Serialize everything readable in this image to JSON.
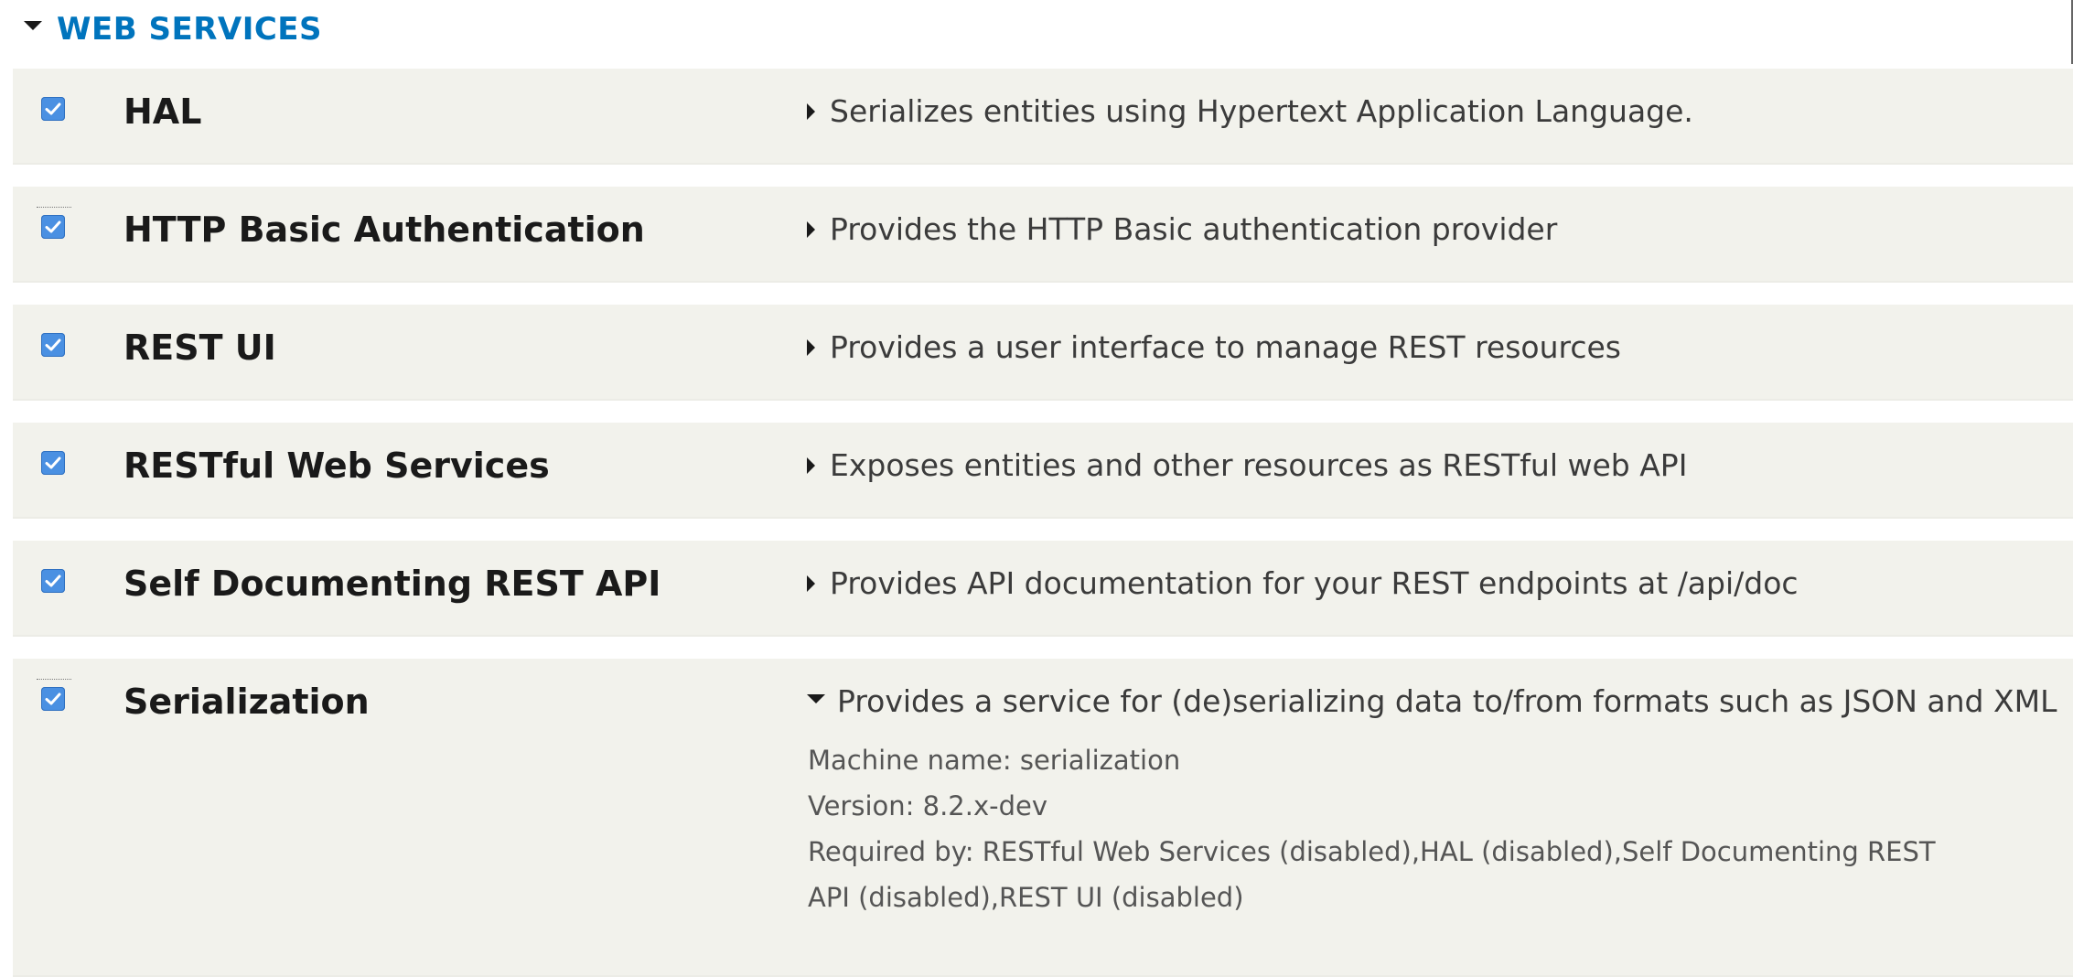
{
  "section": {
    "title": "WEB SERVICES",
    "expanded": true
  },
  "modules": [
    {
      "name": "HAL",
      "enabled": true,
      "description": "Serializes entities using Hypertext Application Language.",
      "expanded": false
    },
    {
      "name": "HTTP Basic Authentication",
      "enabled": true,
      "description": "Provides the HTTP Basic authentication provider",
      "expanded": false
    },
    {
      "name": "REST UI",
      "enabled": true,
      "description": "Provides a user interface to manage REST resources",
      "expanded": false
    },
    {
      "name": "RESTful Web Services",
      "enabled": true,
      "description": "Exposes entities and other resources as RESTful web API",
      "expanded": false
    },
    {
      "name": "Self Documenting REST API",
      "enabled": true,
      "description": "Provides API documentation for your REST endpoints at /api/doc",
      "expanded": false
    },
    {
      "name": "Serialization",
      "enabled": true,
      "description": "Provides a service for (de)serializing data to/from formats such as JSON and XML",
      "expanded": true,
      "details": {
        "machine_name": "Machine name: serialization",
        "version": "Version: 8.2.x-dev",
        "required_by_line1": "Required by: RESTful Web Services (disabled),HAL (disabled),Self Documenting REST",
        "required_by_line2": "API (disabled),REST UI (disabled)"
      }
    }
  ],
  "colors": {
    "section_title": "#0074bd",
    "row_background": "#f2f2ec",
    "checkbox": "#4a90e2",
    "text_dark": "#1a1a1a",
    "text_description": "#3b3b3b"
  }
}
